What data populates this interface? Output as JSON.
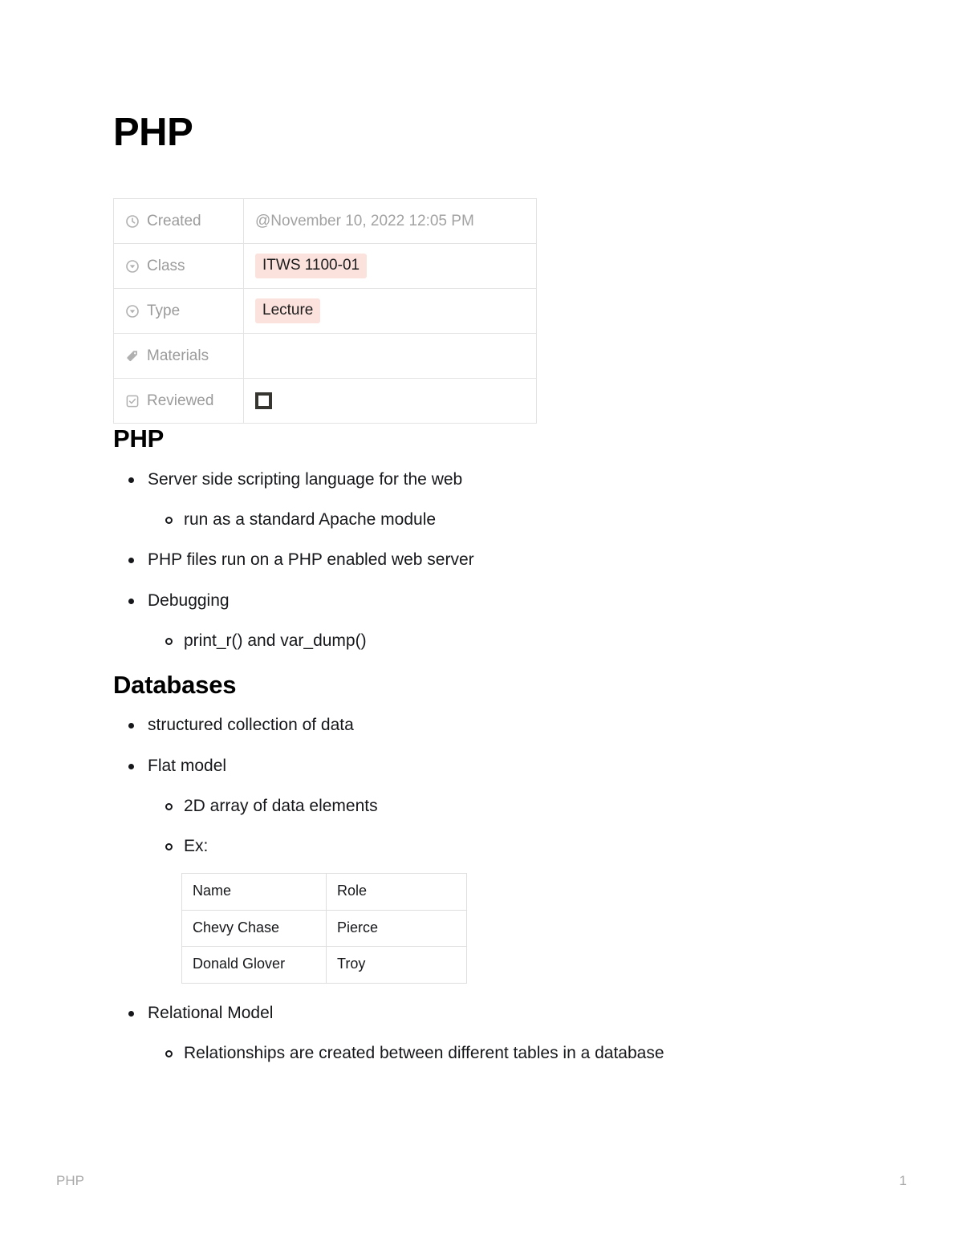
{
  "document": {
    "title": "PHP"
  },
  "properties": {
    "rows": [
      {
        "icon": "clock-icon",
        "label": "Created",
        "value_kind": "plain",
        "value": "@November 10, 2022 12:05 PM"
      },
      {
        "icon": "select-circle-icon",
        "label": "Class",
        "value_kind": "badge",
        "value": "ITWS 1100-01"
      },
      {
        "icon": "select-circle-icon",
        "label": "Type",
        "value_kind": "badge",
        "value": "Lecture"
      },
      {
        "icon": "tag-icon",
        "label": "Materials",
        "value_kind": "empty",
        "value": ""
      },
      {
        "icon": "checkbox-icon",
        "label": "Reviewed",
        "value_kind": "checkbox",
        "value": ""
      }
    ],
    "badge_color": "#fbe2dd",
    "checkbox_checked": false
  },
  "sections": [
    {
      "heading": "PHP",
      "bullets": [
        {
          "text": "Server side scripting language for the web",
          "children": [
            {
              "text": "run as a standard Apache module"
            }
          ]
        },
        {
          "text": "PHP files run on a PHP enabled web server",
          "children": []
        },
        {
          "text": "Debugging",
          "children": [
            {
              "text": "print_r() and var_dump()"
            }
          ]
        }
      ]
    },
    {
      "heading": "Databases",
      "bullets": [
        {
          "text": "structured collection of data",
          "children": []
        },
        {
          "text": "Flat model",
          "children": [
            {
              "text": "2D array of data elements"
            },
            {
              "text": "Ex:"
            }
          ]
        },
        {
          "text": "Relational Model",
          "children": [
            {
              "text": "Relationships are created between different tables in a database"
            }
          ]
        }
      ]
    }
  ],
  "example_table": {
    "headers": [
      "Name",
      "Role"
    ],
    "rows": [
      [
        "Chevy Chase",
        "Pierce"
      ],
      [
        "Donald Glover",
        "Troy"
      ]
    ]
  },
  "footer": {
    "left": "PHP",
    "right": "1"
  }
}
